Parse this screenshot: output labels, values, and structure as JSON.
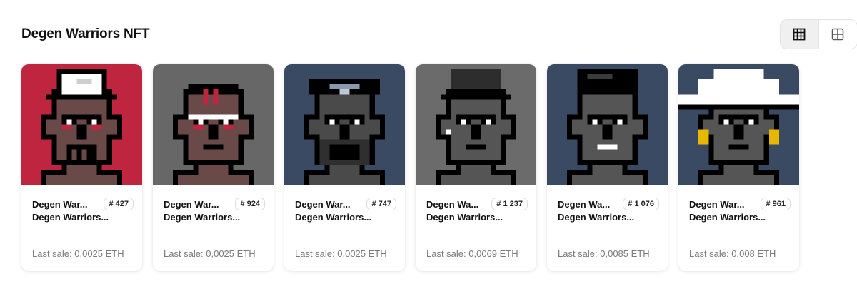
{
  "header": {
    "title": "Degen Warriors NFT"
  },
  "view_toggle": {
    "grid_icon": "grid-3x3-icon",
    "large_grid_icon": "grid-2x2-icon",
    "active": "grid"
  },
  "cards": [
    {
      "name": "Degen War...",
      "badge": "# 427",
      "collection": "Degen Warriors...",
      "sale": "Last sale: 0,0025 ETH",
      "bg": "#c02540",
      "skin": "#6a4a48",
      "hat": "cap-white"
    },
    {
      "name": "Degen War...",
      "badge": "# 924",
      "collection": "Degen Warriors...",
      "sale": "Last sale: 0,0025 ETH",
      "bg": "#676767",
      "skin": "#6a4a48",
      "hat": "headband"
    },
    {
      "name": "Degen War...",
      "badge": "# 747",
      "collection": "Degen Warriors...",
      "sale": "Last sale: 0,0025 ETH",
      "bg": "#3a4a63",
      "skin": "#4a4a4a",
      "hat": "hood"
    },
    {
      "name": "Degen Wa...",
      "badge": "# 1 237",
      "collection": "Degen Warriors...",
      "sale": "Last sale: 0,0069 ETH",
      "bg": "#6b6b6b",
      "skin": "#555555",
      "hat": "beanie"
    },
    {
      "name": "Degen Wa...",
      "badge": "# 1 076",
      "collection": "Degen Warriors...",
      "sale": "Last sale: 0,0085 ETH",
      "bg": "#3a4a63",
      "skin": "#555555",
      "hat": "hair"
    },
    {
      "name": "Degen War...",
      "badge": "# 961",
      "collection": "Degen Warriors...",
      "sale": "Last sale: 0,008 ETH",
      "bg": "#3a4a63",
      "skin": "#555555",
      "hat": "wide-hat"
    }
  ]
}
